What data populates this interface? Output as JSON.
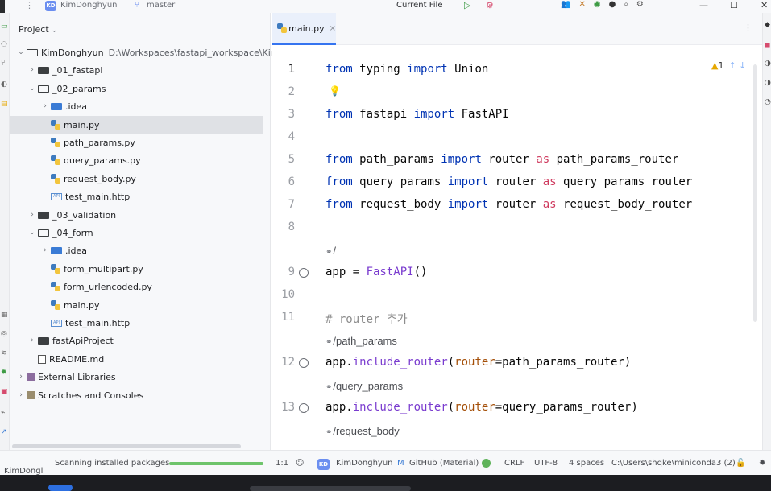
{
  "titlebar": {
    "menu_icon": "hamburger-icon",
    "project_badge": "KD",
    "project_name": "KimDonghyun",
    "branch": "master",
    "run_config": "Current File",
    "window_controls": [
      "—",
      "☐",
      "✕"
    ]
  },
  "project_panel": {
    "title": "Project",
    "tree": [
      {
        "label": "KimDonghyun",
        "path": "D:\\Workspaces\\fastapi_workspace\\KimDo",
        "icon": "folder-open",
        "expanded": true
      },
      {
        "label": "_01_fastapi",
        "icon": "folder",
        "expanded": false
      },
      {
        "label": "_02_params",
        "icon": "folder-open",
        "expanded": true
      },
      {
        "label": ".idea",
        "icon": "idea-folder",
        "expanded": false
      },
      {
        "label": "main.py",
        "icon": "python-file"
      },
      {
        "label": "path_params.py",
        "icon": "python-file"
      },
      {
        "label": "query_params.py",
        "icon": "python-file"
      },
      {
        "label": "request_body.py",
        "icon": "python-file"
      },
      {
        "label": "test_main.http",
        "icon": "http-file"
      },
      {
        "label": "_03_validation",
        "icon": "folder",
        "expanded": false
      },
      {
        "label": "_04_form",
        "icon": "folder-open",
        "expanded": true
      },
      {
        "label": ".idea",
        "icon": "idea-folder",
        "expanded": false
      },
      {
        "label": "form_multipart.py",
        "icon": "python-file"
      },
      {
        "label": "form_urlencoded.py",
        "icon": "python-file"
      },
      {
        "label": "main.py",
        "icon": "python-file"
      },
      {
        "label": "test_main.http",
        "icon": "http-file"
      },
      {
        "label": "fastApiProject",
        "icon": "folder",
        "expanded": false
      },
      {
        "label": "README.md",
        "icon": "markdown-file"
      },
      {
        "label": "External Libraries",
        "icon": "library",
        "expanded": false
      },
      {
        "label": "Scratches and Consoles",
        "icon": "scratches",
        "expanded": false
      }
    ]
  },
  "editor": {
    "tab_label": "main.py",
    "inspection": "1",
    "lines": [
      {
        "n": "1",
        "text": "from typing import Union"
      },
      {
        "n": "2",
        "text": ""
      },
      {
        "n": "3",
        "text": "from fastapi import FastAPI"
      },
      {
        "n": "4",
        "text": ""
      },
      {
        "n": "5",
        "text": "from path_params import router as path_params_router"
      },
      {
        "n": "6",
        "text": "from query_params import router as query_params_router"
      },
      {
        "n": "7",
        "text": "from request_body import router as request_body_router"
      },
      {
        "n": "8",
        "text": ""
      },
      {
        "n": "9",
        "text": "app = FastAPI()"
      },
      {
        "n": "10",
        "text": ""
      },
      {
        "n": "11",
        "text": "# router 추가"
      },
      {
        "n": "12",
        "text": "app.include_router(router=path_params_router)"
      },
      {
        "n": "13",
        "text": "app.include_router(router=query_params_router)"
      }
    ],
    "hints": [
      "/",
      "/path_params",
      "/query_params",
      "/request_body"
    ],
    "code_tokens": {
      "l1": [
        "from",
        " typing ",
        "import",
        " Union"
      ],
      "l3": [
        "from",
        " fastapi ",
        "import",
        " FastAPI"
      ],
      "l5": [
        "from",
        " path_params ",
        "import",
        " router ",
        "as",
        " path_params_router"
      ],
      "l6": [
        "from",
        " query_params ",
        "import",
        " router ",
        "as",
        " query_params_router"
      ],
      "l7": [
        "from",
        " request_body ",
        "import",
        " router ",
        "as",
        " request_body_router"
      ],
      "l9": [
        "app = ",
        "FastAPI",
        "()"
      ],
      "l11": "# router 추가",
      "l12": [
        "app.",
        "include_router",
        "(",
        "router",
        "=path_params_router)"
      ],
      "l13": [
        "app.",
        "include_router",
        "(",
        "router",
        "=query_params_router)"
      ]
    }
  },
  "status_bar": {
    "breadcrumb": "KimDongl",
    "task": "Scanning installed packages...",
    "progress": 1.0,
    "position": "1:1",
    "account_badge": "KD",
    "account": "KimDonghyun",
    "theme": "GitHub (Material)",
    "line_ending": "CRLF",
    "encoding": "UTF-8",
    "indent": "4 spaces",
    "interpreter": "C:\\Users\\shqke\\miniconda3 (2)"
  },
  "colors": {
    "keyword": "#0033b3",
    "keyword_as": "#cf3a5e",
    "function": "#7a3ccf",
    "parameter": "#a44f08",
    "comment": "#8c8c8c",
    "accent": "#3574f0",
    "progress": "#6ec46b"
  }
}
